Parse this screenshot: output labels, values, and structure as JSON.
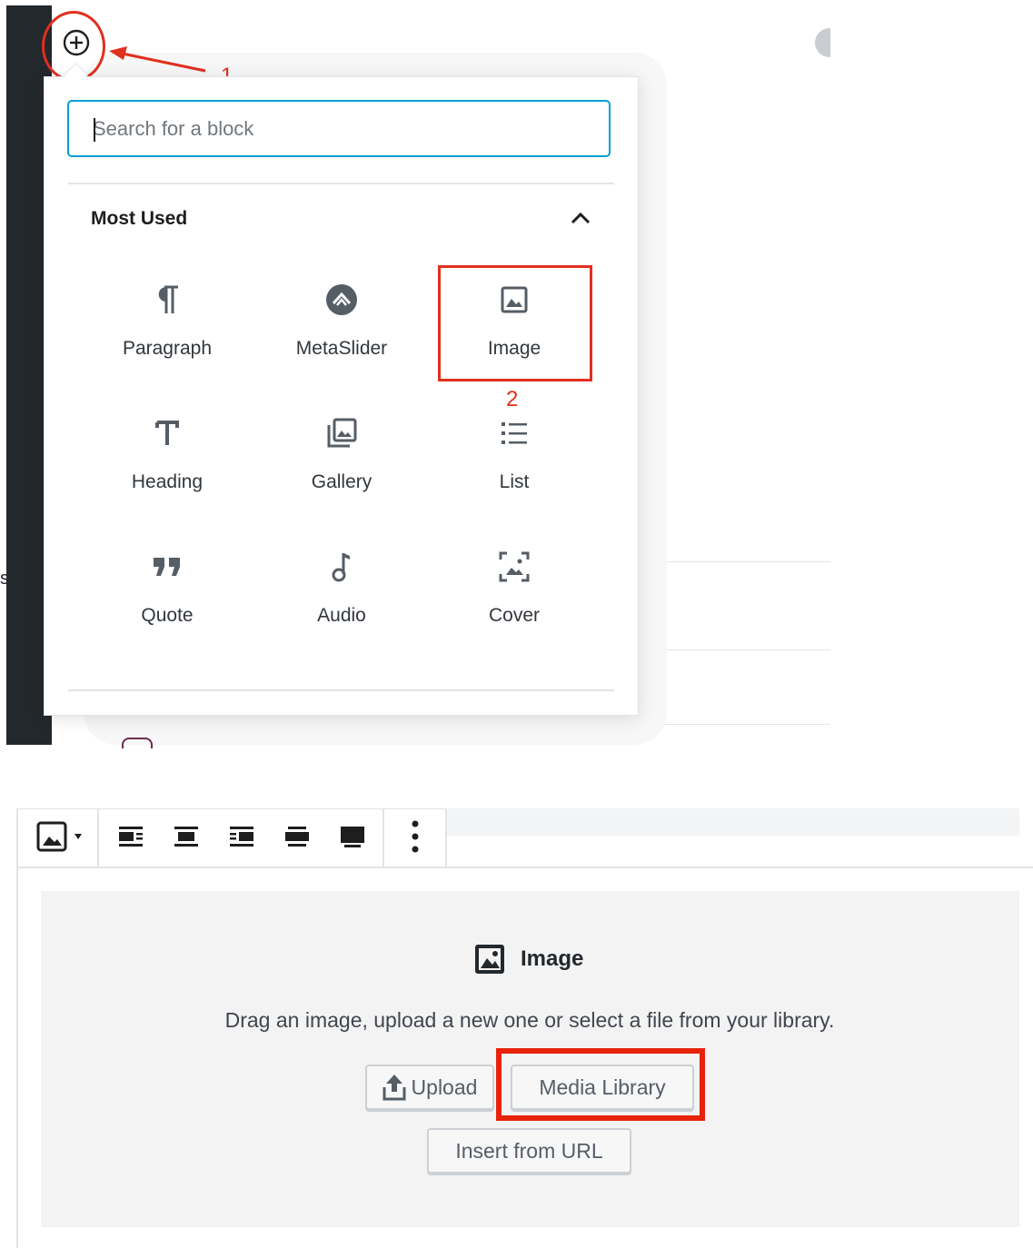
{
  "colors": {
    "accent": "#00a0d2",
    "annotation_red": "#e0301e",
    "admin_bar": "#23282d",
    "panel_bg": "#f3f3f4"
  },
  "sidebar": {
    "partial_char": "s"
  },
  "inserter": {
    "toggle_icon": "plus-circle-icon",
    "search": {
      "placeholder": "Search for a block"
    },
    "section": {
      "title": "Most Used",
      "collapse_icon": "chevron-up-icon"
    },
    "blocks": [
      {
        "label": "Paragraph",
        "icon": "paragraph-icon"
      },
      {
        "label": "MetaSlider",
        "icon": "metaslider-icon"
      },
      {
        "label": "Image",
        "icon": "image-icon"
      },
      {
        "label": "Heading",
        "icon": "heading-icon"
      },
      {
        "label": "Gallery",
        "icon": "gallery-icon"
      },
      {
        "label": "List",
        "icon": "list-icon"
      },
      {
        "label": "Quote",
        "icon": "quote-icon"
      },
      {
        "label": "Audio",
        "icon": "audio-icon"
      },
      {
        "label": "Cover",
        "icon": "cover-icon"
      }
    ]
  },
  "annotations": {
    "step1": "1",
    "step2": "2"
  },
  "block_toolbar": {
    "buttons": [
      "image-type-icon",
      "align-left-icon",
      "align-center-icon",
      "align-right-icon",
      "wide-width-icon",
      "full-width-icon",
      "more-options-icon"
    ]
  },
  "image_placeholder": {
    "title": "Image",
    "description": "Drag an image, upload a new one or select a file from your library.",
    "upload_label": "Upload",
    "media_library_label": "Media Library",
    "insert_url_label": "Insert from URL"
  }
}
